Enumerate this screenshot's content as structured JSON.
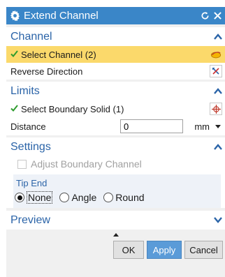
{
  "dialog": {
    "title": "Extend Channel",
    "icons": {
      "title_icon": "gear-icon",
      "reset": "reset-icon",
      "close": "close-icon"
    }
  },
  "groups": {
    "channel": {
      "title": "Channel",
      "select_channel": "Select Channel (2)",
      "reverse_direction": "Reverse Direction"
    },
    "limits": {
      "title": "Limits",
      "select_boundary": "Select Boundary Solid (1)",
      "distance_label": "Distance",
      "distance_value": "0",
      "unit": "mm"
    },
    "settings": {
      "title": "Settings",
      "adjust_boundary": "Adjust Boundary Channel",
      "tip_end": {
        "title": "Tip End",
        "options": [
          "None",
          "Angle",
          "Round"
        ],
        "selected": "None"
      }
    },
    "preview": {
      "title": "Preview"
    }
  },
  "footer": {
    "ok": "OK",
    "apply": "Apply",
    "cancel": "Cancel"
  },
  "colors": {
    "titlebar": "#3a86c8",
    "group_title": "#2b64a8",
    "selected_row": "#fbd96b",
    "apply_button": "#5a9bd8"
  }
}
